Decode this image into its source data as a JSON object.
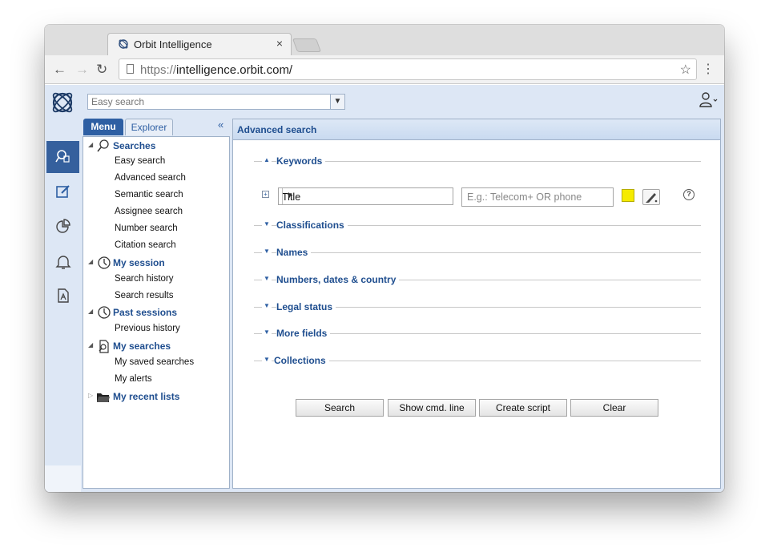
{
  "browser": {
    "tab_title": "Orbit Intelligence",
    "tab_close": "×",
    "url_protocol": "https://",
    "url_host": "intelligence.orbit.com/"
  },
  "app": {
    "easy_search_placeholder": "Easy search",
    "panel_tabs": {
      "menu": "Menu",
      "explorer": "Explorer",
      "collapse": "«"
    },
    "tree": {
      "searches": {
        "label": "Searches",
        "items": [
          "Easy search",
          "Advanced search",
          "Semantic search",
          "Assignee search",
          "Number search",
          "Citation search"
        ]
      },
      "my_session": {
        "label": "My session",
        "items": [
          "Search history",
          "Search results"
        ]
      },
      "past_sessions": {
        "label": "Past sessions",
        "items": [
          "Previous history"
        ]
      },
      "my_searches": {
        "label": "My searches",
        "items": [
          "My saved searches",
          "My alerts"
        ]
      },
      "my_recent_lists": {
        "label": "My recent lists"
      }
    },
    "main": {
      "title": "Advanced search",
      "keywords": {
        "label": "Keywords",
        "field_value": "Title",
        "input_placeholder": "E.g.: Telecom+ OR phone",
        "highlight_color": "#f5eb00",
        "help": "?"
      },
      "sections": [
        "Classifications",
        "Names",
        "Numbers, dates & country",
        "Legal status",
        "More fields",
        "Collections"
      ],
      "buttons": {
        "search": "Search",
        "show_cmd": "Show cmd. line",
        "create_script": "Create script",
        "clear": "Clear"
      }
    }
  },
  "colors": {
    "accent": "#2e5fa3",
    "label": "#1f4e8f",
    "rail_active": "#35609d"
  }
}
